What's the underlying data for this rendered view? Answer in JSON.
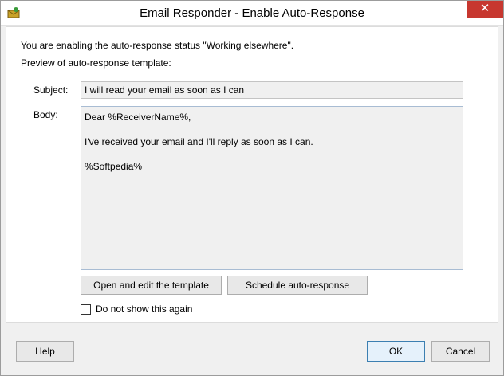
{
  "window": {
    "title": "Email Responder - Enable Auto-Response",
    "close_glyph": "✕",
    "icon": "app-envelope-icon"
  },
  "intro": {
    "line1": "You are enabling the auto-response status \"Working elsewhere\".",
    "line2": "Preview of auto-response template:"
  },
  "template": {
    "subject_label": "Subject:",
    "subject_value": "I will read your email as soon as I can",
    "body_label": "Body:",
    "body_lines": [
      "Dear %ReceiverName%,",
      "I've received your email and I'll reply as soon as I can.",
      "%Softpedia%"
    ]
  },
  "actions": {
    "open_edit_label": "Open and edit the template",
    "schedule_label": "Schedule auto-response"
  },
  "checkbox": {
    "label": "Do not show this again",
    "checked": false
  },
  "footer": {
    "help_label": "Help",
    "ok_label": "OK",
    "cancel_label": "Cancel"
  },
  "colors": {
    "close_button": "#c7372f",
    "ok_border": "#3c7fb1"
  }
}
